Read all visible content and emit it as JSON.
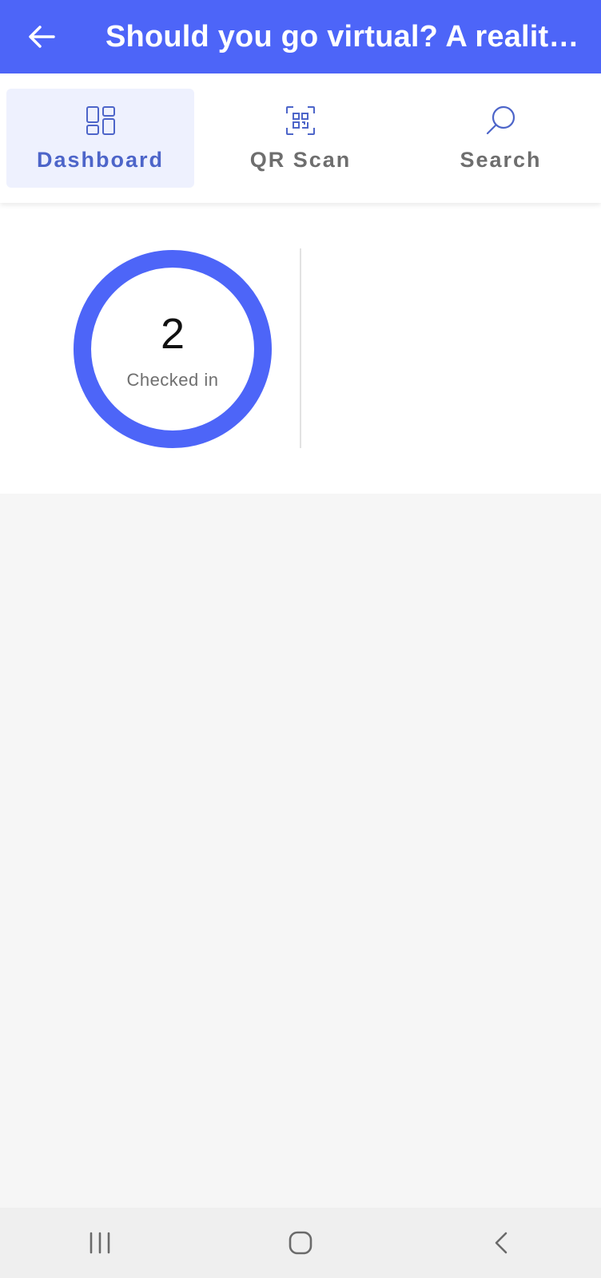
{
  "appbar": {
    "title": "Should you go virtual? A reality ...",
    "back_icon": "arrow-left-icon",
    "background": "#4d65f8"
  },
  "tabs": [
    {
      "label": "Dashboard",
      "icon": "dashboard-icon",
      "active": true
    },
    {
      "label": "QR Scan",
      "icon": "qr-scan-icon",
      "active": false
    },
    {
      "label": "Search",
      "icon": "search-icon",
      "active": false
    }
  ],
  "stats": {
    "checked_in_count": "2",
    "checked_in_label": "Checked in"
  },
  "navbar": {
    "icons": [
      "recent-apps-icon",
      "home-icon",
      "back-icon"
    ]
  },
  "colors": {
    "accent": "#4d65f8",
    "active_tab_text": "#4d65c9",
    "active_tab_bg": "#eef1fe"
  }
}
